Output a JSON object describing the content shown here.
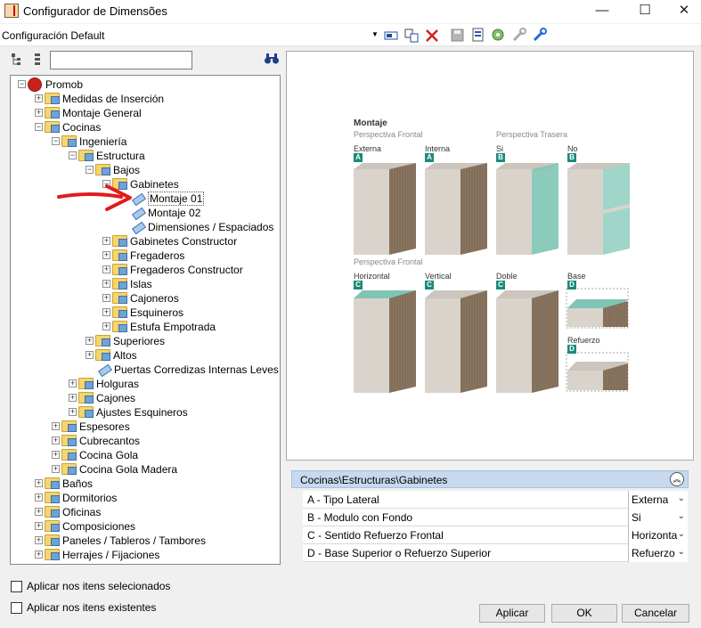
{
  "window": {
    "title": "Configurador de Dimensões",
    "minimize": "—",
    "maximize": "☐",
    "close": "✕"
  },
  "config": {
    "selected": "Configuración Default",
    "dropdown": "▼"
  },
  "tree": {
    "search_value": "",
    "nodes": [
      {
        "label": "Promob",
        "level": 0,
        "exp": "−",
        "icon": "root"
      },
      {
        "label": "Medidas de Inserción",
        "level": 1,
        "exp": "+",
        "icon": "folder"
      },
      {
        "label": "Montaje General",
        "level": 1,
        "exp": "+",
        "icon": "folder"
      },
      {
        "label": "Cocinas",
        "level": 1,
        "exp": "−",
        "icon": "folder"
      },
      {
        "label": "Ingeniería",
        "level": 2,
        "exp": "−",
        "icon": "folder"
      },
      {
        "label": "Estructura",
        "level": 3,
        "exp": "−",
        "icon": "folder"
      },
      {
        "label": "Bajos",
        "level": 4,
        "exp": "−",
        "icon": "folder"
      },
      {
        "label": "Gabinetes",
        "level": 5,
        "exp": "−",
        "icon": "folder"
      },
      {
        "label": "Montaje 01",
        "level": 6,
        "exp": "",
        "icon": "tag",
        "selected": true
      },
      {
        "label": "Montaje 02",
        "level": 6,
        "exp": "",
        "icon": "tag"
      },
      {
        "label": "Dimensiones / Espaciados",
        "level": 6,
        "exp": "",
        "icon": "tag"
      },
      {
        "label": "Gabinetes Constructor",
        "level": 5,
        "exp": "+",
        "icon": "folder"
      },
      {
        "label": "Fregaderos",
        "level": 5,
        "exp": "+",
        "icon": "folder"
      },
      {
        "label": "Fregaderos Constructor",
        "level": 5,
        "exp": "+",
        "icon": "folder"
      },
      {
        "label": "Islas",
        "level": 5,
        "exp": "+",
        "icon": "folder"
      },
      {
        "label": "Cajoneros",
        "level": 5,
        "exp": "+",
        "icon": "folder"
      },
      {
        "label": "Esquineros",
        "level": 5,
        "exp": "+",
        "icon": "folder"
      },
      {
        "label": "Estufa Empotrada",
        "level": 5,
        "exp": "+",
        "icon": "folder"
      },
      {
        "label": "Superiores",
        "level": 4,
        "exp": "+",
        "icon": "folder"
      },
      {
        "label": "Altos",
        "level": 4,
        "exp": "+",
        "icon": "folder"
      },
      {
        "label": "Puertas Corredizas Internas Leves",
        "level": 4,
        "exp": "",
        "icon": "tag"
      },
      {
        "label": "Holguras",
        "level": 3,
        "exp": "+",
        "icon": "folder"
      },
      {
        "label": "Cajones",
        "level": 3,
        "exp": "+",
        "icon": "folder"
      },
      {
        "label": "Ajustes Esquineros",
        "level": 3,
        "exp": "+",
        "icon": "folder"
      },
      {
        "label": "Espesores",
        "level": 2,
        "exp": "+",
        "icon": "folder"
      },
      {
        "label": "Cubrecantos",
        "level": 2,
        "exp": "+",
        "icon": "folder"
      },
      {
        "label": "Cocina Gola",
        "level": 2,
        "exp": "+",
        "icon": "folder"
      },
      {
        "label": "Cocina Gola Madera",
        "level": 2,
        "exp": "+",
        "icon": "folder"
      },
      {
        "label": "Baños",
        "level": 1,
        "exp": "+",
        "icon": "folder"
      },
      {
        "label": "Dormitorios",
        "level": 1,
        "exp": "+",
        "icon": "folder"
      },
      {
        "label": "Oficinas",
        "level": 1,
        "exp": "+",
        "icon": "folder"
      },
      {
        "label": "Composiciones",
        "level": 1,
        "exp": "+",
        "icon": "folder"
      },
      {
        "label": "Paneles / Tableros / Tambores",
        "level": 1,
        "exp": "+",
        "icon": "folder"
      },
      {
        "label": "Herrajes / Fijaciones",
        "level": 1,
        "exp": "+",
        "icon": "folder"
      }
    ]
  },
  "options": {
    "apply_selected": "Aplicar nos itens selecionados",
    "apply_existing": "Aplicar nos itens existentes"
  },
  "preview": {
    "title": "Montaje",
    "front": "Perspectiva Frontal",
    "back": "Perspectiva Trasera",
    "front2": "Perspectiva Frontal",
    "labels": {
      "externa": "Externa",
      "interna": "Interna",
      "si": "Si",
      "no": "No",
      "horizontal": "Horizontal",
      "vertical": "Vertical",
      "doble": "Doble",
      "base": "Base",
      "refuerzo": "Refuerzo"
    },
    "badges": {
      "a": "A",
      "b": "B",
      "c": "C",
      "d": "D"
    },
    "colors": {
      "wood": "#8b7660",
      "panel": "#d8d2cb",
      "glass": "#7fc4b5",
      "badge": "#1b8a79"
    }
  },
  "properties": {
    "header": "Cocinas\\Estructuras\\Gabinetes",
    "rows": [
      {
        "name": "A - Tipo Lateral",
        "value": "Externa"
      },
      {
        "name": "B - Modulo con Fondo",
        "value": "Si"
      },
      {
        "name": "C - Sentido Refuerzo Frontal",
        "value": "Horizonta"
      },
      {
        "name": "D - Base Superior o Refuerzo Superior",
        "value": "Refuerzo"
      }
    ]
  },
  "buttons": {
    "apply": "Aplicar",
    "ok": "OK",
    "cancel": "Cancelar"
  }
}
